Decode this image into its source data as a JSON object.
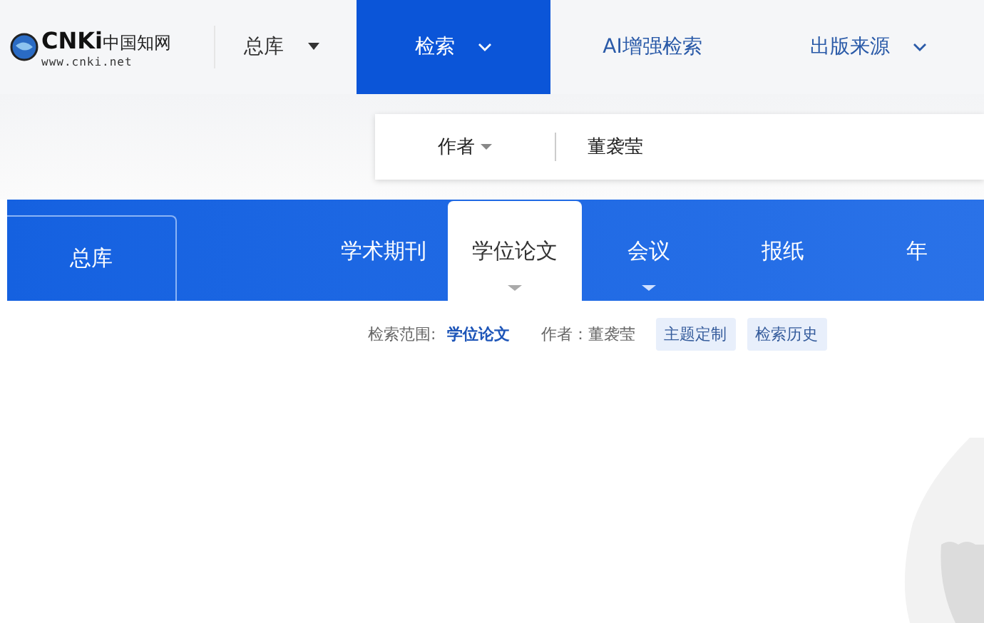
{
  "logo": {
    "brand": "CNKi",
    "name": "中国知网",
    "url": "www.cnki.net"
  },
  "nav": [
    {
      "label": "总库",
      "selected": false,
      "dropdown": true
    },
    {
      "label": "检索",
      "selected": true,
      "dropdown": true
    },
    {
      "label": "AI增强检索",
      "selected": false,
      "dropdown": false
    },
    {
      "label": "出版来源",
      "selected": false,
      "dropdown": true
    }
  ],
  "search": {
    "field": "作者",
    "value": "董袭莹"
  },
  "db_tabs": {
    "main": "总库",
    "items": [
      {
        "label": "学术期刊",
        "selected": false,
        "dropdown": false
      },
      {
        "label": "学位论文",
        "selected": true,
        "dropdown": true
      },
      {
        "label": "会议",
        "selected": false,
        "dropdown": true
      },
      {
        "label": "报纸",
        "selected": false,
        "dropdown": false
      },
      {
        "label": "年",
        "selected": false,
        "dropdown": false
      }
    ]
  },
  "scope": {
    "label": "检索范围:",
    "value": "学位论文",
    "author": "作者：董袭莹",
    "buttons": [
      "主题定制",
      "检索历史"
    ]
  }
}
